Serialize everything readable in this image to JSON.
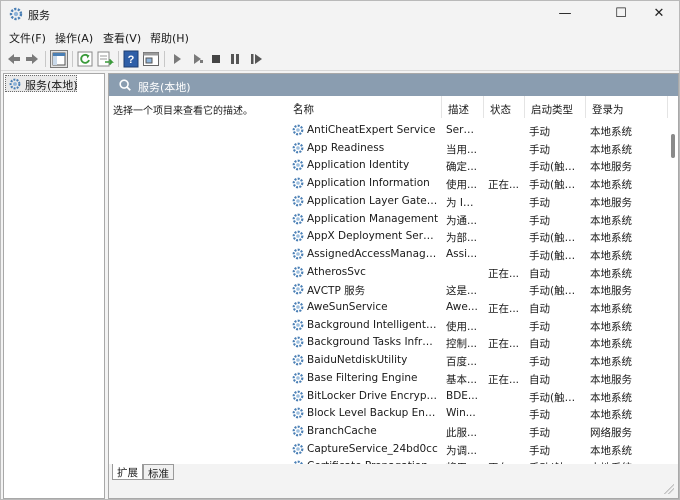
{
  "window": {
    "title": "服务",
    "buttons": {
      "minimize": "—",
      "maximize": "☐",
      "close": "✕"
    }
  },
  "menu": [
    "文件(F)",
    "操作(A)",
    "查看(V)",
    "帮助(H)"
  ],
  "toolbar": {
    "icons": [
      "back-arrow-icon",
      "forward-arrow-icon",
      "show-tree-icon",
      "refresh-icon",
      "export-list-icon",
      "help-icon",
      "properties-icon",
      "start-service-icon",
      "start-service-alt-icon",
      "stop-service-icon",
      "pause-service-icon",
      "restart-service-icon"
    ]
  },
  "tree": {
    "root_label": "服务(本地)"
  },
  "main": {
    "header_title": "服务(本地)",
    "description_prompt": "选择一个项目来查看它的描述。",
    "columns": [
      "名称",
      "描述",
      "状态",
      "启动类型",
      "登录为"
    ],
    "sort_indicator": "^",
    "rows": [
      {
        "name": "AntiCheatExpert Service",
        "desc": "Servi...",
        "status": "",
        "startup": "手动",
        "logon": "本地系统"
      },
      {
        "name": "App Readiness",
        "desc": "当用...",
        "status": "",
        "startup": "手动",
        "logon": "本地系统"
      },
      {
        "name": "Application Identity",
        "desc": "确定...",
        "status": "",
        "startup": "手动(触发...",
        "logon": "本地服务"
      },
      {
        "name": "Application Information",
        "desc": "使用...",
        "status": "正在...",
        "startup": "手动(触发...",
        "logon": "本地系统"
      },
      {
        "name": "Application Layer Gatewa...",
        "desc": "为 In...",
        "status": "",
        "startup": "手动",
        "logon": "本地服务"
      },
      {
        "name": "Application Management",
        "desc": "为通...",
        "status": "",
        "startup": "手动",
        "logon": "本地系统"
      },
      {
        "name": "AppX Deployment Servic...",
        "desc": "为部...",
        "status": "",
        "startup": "手动(触发...",
        "logon": "本地系统"
      },
      {
        "name": "AssignedAccessManager...",
        "desc": "Assi...",
        "status": "",
        "startup": "手动(触发...",
        "logon": "本地系统"
      },
      {
        "name": "AtherosSvc",
        "desc": "",
        "status": "正在...",
        "startup": "自动",
        "logon": "本地系统"
      },
      {
        "name": "AVCTP 服务",
        "desc": "这是...",
        "status": "",
        "startup": "手动(触发...",
        "logon": "本地服务"
      },
      {
        "name": "AweSunService",
        "desc": "Awe...",
        "status": "正在...",
        "startup": "自动",
        "logon": "本地系统"
      },
      {
        "name": "Background Intelligent T...",
        "desc": "使用...",
        "status": "",
        "startup": "手动",
        "logon": "本地系统"
      },
      {
        "name": "Background Tasks Infras...",
        "desc": "控制...",
        "status": "正在...",
        "startup": "自动",
        "logon": "本地系统"
      },
      {
        "name": "BaiduNetdiskUtility",
        "desc": "百度...",
        "status": "",
        "startup": "手动",
        "logon": "本地系统"
      },
      {
        "name": "Base Filtering Engine",
        "desc": "基本...",
        "status": "正在...",
        "startup": "自动",
        "logon": "本地服务"
      },
      {
        "name": "BitLocker Drive Encryptio...",
        "desc": "BDE...",
        "status": "",
        "startup": "手动(触发...",
        "logon": "本地系统"
      },
      {
        "name": "Block Level Backup Engi...",
        "desc": "Win...",
        "status": "",
        "startup": "手动",
        "logon": "本地系统"
      },
      {
        "name": "BranchCache",
        "desc": "此服...",
        "status": "",
        "startup": "手动",
        "logon": "网络服务"
      },
      {
        "name": "CaptureService_24bd0cc",
        "desc": "为调...",
        "status": "",
        "startup": "手动",
        "logon": "本地系统"
      },
      {
        "name": "Certificate Propagation",
        "desc": "将用...",
        "status": "正在...",
        "startup": "手动(触发...",
        "logon": "本地系统"
      }
    ]
  },
  "tabs": [
    "扩展",
    "标准"
  ],
  "colors": {
    "header_bar": "#8a9db0",
    "window_bg": "#f3f3f3",
    "gear_icon": "#4a7fb5"
  }
}
